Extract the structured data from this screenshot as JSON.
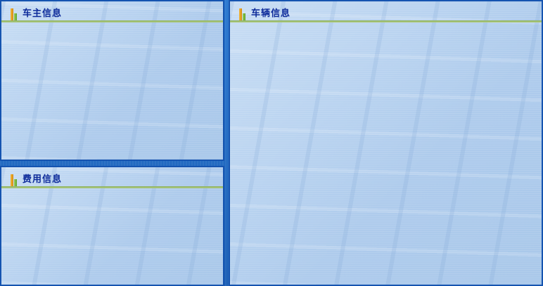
{
  "panels": {
    "owner": {
      "title": "车主信息"
    },
    "vehicle": {
      "title": "车辆信息"
    },
    "fee": {
      "title": "费用信息"
    }
  },
  "icons": {
    "header_icon": "bar-chart-icon"
  },
  "colors": {
    "frame_blue": "#1554b0",
    "title_text": "#0c2a9a",
    "header_rule": "#9fbf6f",
    "icon_orange": "#e8a22a",
    "icon_green": "#7cbf45"
  }
}
